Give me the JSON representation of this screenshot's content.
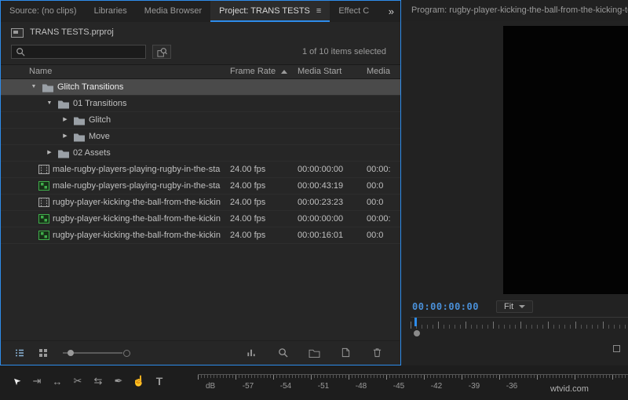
{
  "colors": {
    "accent": "#2d8ceb",
    "selection_row": "#4a4a4a",
    "timecode_blue": "#4a90d9",
    "label_orange": "#d7903b",
    "label_purple": "#9d85d2",
    "label_blue": "#6f9fd8",
    "label_green": "#49b649"
  },
  "tabs": {
    "source": "Source: (no clips)",
    "libraries": "Libraries",
    "media_browser": "Media Browser",
    "project": "Project: TRANS TESTS",
    "effects": "Effect C",
    "overflow": "»",
    "program": "Program: rugby-player-kicking-the-ball-from-the-kicking-tee-..."
  },
  "project": {
    "file_name": "TRANS TESTS.prproj",
    "status": "1 of 10 items selected",
    "search_value": "",
    "columns": {
      "name": "Name",
      "frame_rate": "Frame Rate",
      "media_start": "Media Start",
      "media": "Media"
    },
    "rows": [
      {
        "name": "Glitch Transitions",
        "type": "bin",
        "depth": 0,
        "expanded": true,
        "selected": true,
        "label_color": "#d7903b"
      },
      {
        "name": "01 Transitions",
        "type": "bin",
        "depth": 1,
        "expanded": true,
        "selected": false,
        "label_color": "#d7903b"
      },
      {
        "name": "Glitch",
        "type": "bin",
        "depth": 2,
        "expanded": false,
        "selected": false,
        "label_color": "#d7903b"
      },
      {
        "name": "Move",
        "type": "bin",
        "depth": 2,
        "expanded": false,
        "selected": false,
        "label_color": "#d7903b"
      },
      {
        "name": "02 Assets",
        "type": "bin",
        "depth": 1,
        "expanded": false,
        "selected": false,
        "label_color": "#d7903b"
      },
      {
        "name": "male-rugby-players-playing-rugby-in-the-sta",
        "type": "clip",
        "label_color": "#9d85d2",
        "frame_rate": "24.00 fps",
        "media_start": "00:00:00:00",
        "media": "00:00:"
      },
      {
        "name": "male-rugby-players-playing-rugby-in-the-sta",
        "type": "sequence",
        "label_color": "#6f9fd8",
        "frame_rate": "24.00 fps",
        "media_start": "00:00:43:19",
        "media": "00:0"
      },
      {
        "name": "rugby-player-kicking-the-ball-from-the-kickin",
        "type": "clip",
        "label_color": "#9d85d2",
        "frame_rate": "24.00 fps",
        "media_start": "00:00:23:23",
        "media": "00:0"
      },
      {
        "name": "rugby-player-kicking-the-ball-from-the-kickin",
        "type": "sequence",
        "label_color": "#49b649",
        "frame_rate": "24.00 fps",
        "media_start": "00:00:00:00",
        "media": "00:00:"
      },
      {
        "name": "rugby-player-kicking-the-ball-from-the-kickin",
        "type": "sequence",
        "label_color": "#6f9fd8",
        "frame_rate": "24.00 fps",
        "media_start": "00:00:16:01",
        "media": "00:0"
      }
    ]
  },
  "program": {
    "timecode": "00:00:00:00",
    "zoom_select": "Fit"
  },
  "tools": {
    "items": [
      {
        "name": "selection-tool",
        "glyph": "➤",
        "active": true
      },
      {
        "name": "track-select-forward-tool",
        "glyph": "⇥",
        "active": false
      },
      {
        "name": "ripple-edit-tool",
        "glyph": "↔",
        "active": false
      },
      {
        "name": "razor-tool",
        "glyph": "✂",
        "active": false
      },
      {
        "name": "slip-tool",
        "glyph": "⇆",
        "active": false
      },
      {
        "name": "pen-tool",
        "glyph": "✒",
        "active": false
      },
      {
        "name": "hand-tool",
        "glyph": "☝",
        "active": false
      },
      {
        "name": "type-tool",
        "glyph": "T",
        "active": false
      }
    ]
  },
  "audio_meter": {
    "labels": [
      "dB",
      "-57",
      "-54",
      "-51",
      "-48",
      "-45",
      "-42",
      "-39",
      "-36"
    ]
  },
  "watermark": "wtvid.com"
}
